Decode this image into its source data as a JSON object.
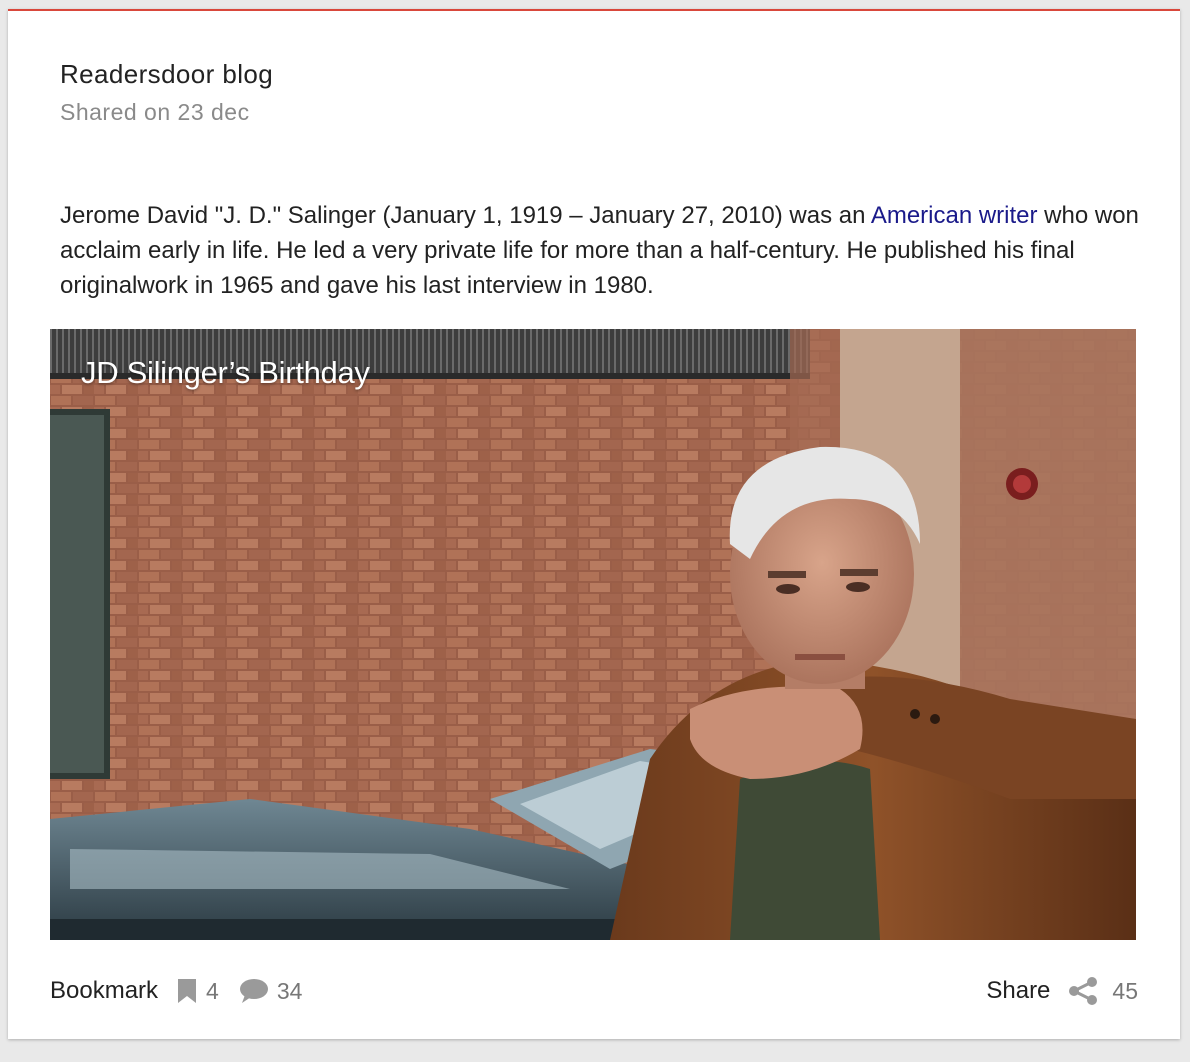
{
  "card": {
    "blog_name": "Readersdoor blog",
    "shared_date": "Shared on 23 dec"
  },
  "post": {
    "text_before_link": "Jerome David \"J. D.\" Salinger (January 1, 1919 – January 27, 2010) was an ",
    "link_text": "American writer",
    "text_after_link": " who won acclaim early in life. He led a very private life for more than a half-century. He published his final originalwork in 1965 and gave his last interview in 1980."
  },
  "photo": {
    "caption": "JD Silinger’s Birthday"
  },
  "footer": {
    "bookmark_label": "Bookmark",
    "bookmark_icon": "bookmark-icon",
    "bookmark_count": "4",
    "comment_icon": "comment-icon",
    "comment_count": "34",
    "share_label": "Share",
    "share_icon": "share-icon",
    "share_count": "45"
  },
  "colors": {
    "accent_top_border": "#d9473b",
    "link": "#1a1a8a",
    "muted_text": "#8a8a8a",
    "icon_gray": "#9a9a9a"
  }
}
